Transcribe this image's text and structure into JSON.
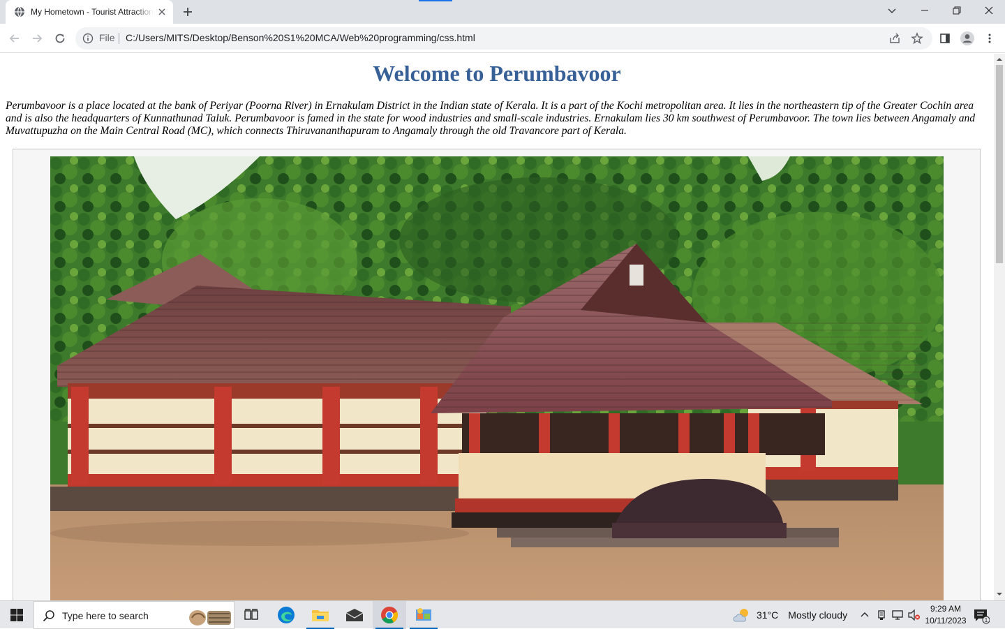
{
  "browser": {
    "tab_title": "My Hometown - Tourist Attractions",
    "scheme_label": "File",
    "url": "C:/Users/MITS/Desktop/Benson%20S1%20MCA/Web%20programming/css.html"
  },
  "page": {
    "heading": "Welcome to Perumbavoor",
    "intro": "Perumbavoor is a place located at the bank of Periyar (Poorna River) in Ernakulam District in the Indian state of Kerala. It is a part of the Kochi metropolitan area. It lies in the northeastern tip of the Greater Cochin area and is also the headquarters of Kunnathunad Taluk. Perumbavoor is famed in the state for wood industries and small-scale industries. Ernakulam lies 30 km southwest of Perumbavoor. The town lies between Angamaly and Muvattupuzha on the Main Central Road (MC), which connects Thiruvananthapuram to Angamaly through the old Travancore part of Kerala."
  },
  "taskbar": {
    "search_placeholder": "Type here to search",
    "weather_temp": "31°C",
    "weather_desc": "Mostly cloudy",
    "time": "9:29 AM",
    "date": "10/11/2023",
    "notification_count": "1"
  },
  "colors": {
    "heading": "#376097",
    "accent": "#1a73e8",
    "taskbar_running": "#0063b1"
  },
  "icons": [
    "globe-icon",
    "close-icon",
    "plus-icon",
    "chevron-down-icon",
    "minimize-icon",
    "restore-icon",
    "back-icon",
    "forward-icon",
    "reload-icon",
    "info-icon",
    "share-icon",
    "star-icon",
    "side-panel-icon",
    "profile-icon",
    "more-icon",
    "windows-icon",
    "search-icon",
    "task-view-icon",
    "edge-icon",
    "file-explorer-icon",
    "mail-icon",
    "chrome-icon",
    "control-panel-icon",
    "weather-icon",
    "chevron-up-icon",
    "usb-icon",
    "network-icon",
    "volume-muted-icon",
    "notification-icon"
  ]
}
